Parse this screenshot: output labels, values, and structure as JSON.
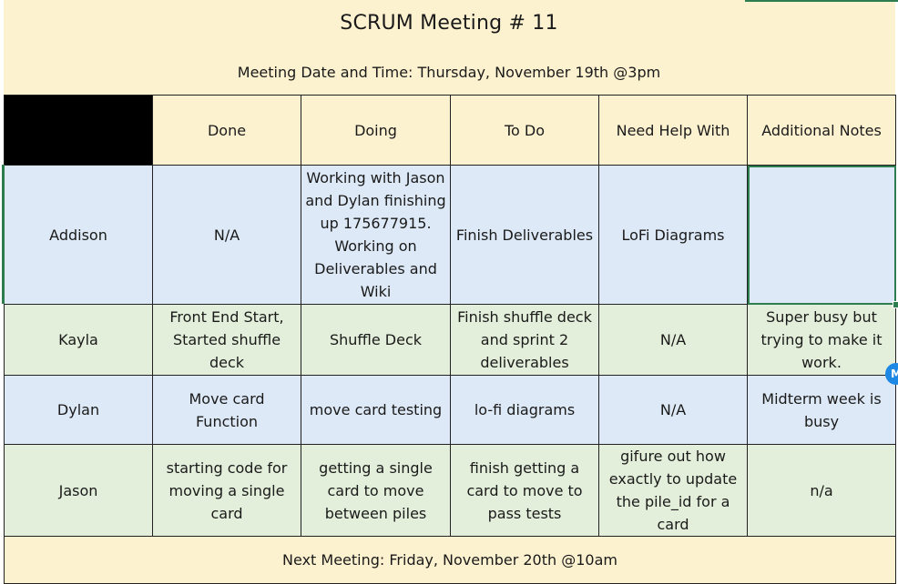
{
  "title": "SCRUM Meeting # 11",
  "subtitle": "Meeting Date and Time: Thursday, November 19th @3pm",
  "columns": [
    "",
    "Done",
    "Doing",
    "To Do",
    "Need Help With",
    "Additional Notes"
  ],
  "rows": [
    {
      "name": "Addison",
      "done": "N/A",
      "doing": "Working with Jason and Dylan finishing up 175677915. Working on Deliverables and Wiki",
      "todo": "Finish Deliverables",
      "help": "LoFi Diagrams",
      "notes": ""
    },
    {
      "name": "Kayla",
      "done": "Front End Start, Started shuffle deck",
      "doing": "Shuffle Deck",
      "todo": "Finish shuffle deck and sprint 2 deliverables",
      "help": "N/A",
      "notes": "Super busy but trying to make it work."
    },
    {
      "name": "Dylan",
      "done": "Move card Function",
      "doing": "move card testing",
      "todo": "lo-fi diagrams",
      "help": "N/A",
      "notes": "Midterm week is busy"
    },
    {
      "name": "Jason",
      "done": "starting code for moving a single card",
      "doing": "getting a single card to move between piles",
      "todo": "finish getting a card to move to pass tests",
      "help": "gifure out how exactly to update the pile_id for a card",
      "notes": "n/a"
    }
  ],
  "footer": "Next Meeting: Friday, November 20th @10am",
  "avatar_initial": "M",
  "colors": {
    "header_bg": "#fdf2d0",
    "blue_row": "#dde9f6",
    "green_row": "#e3efda",
    "selection": "#2e7d4f",
    "avatar": "#1e88e5"
  }
}
